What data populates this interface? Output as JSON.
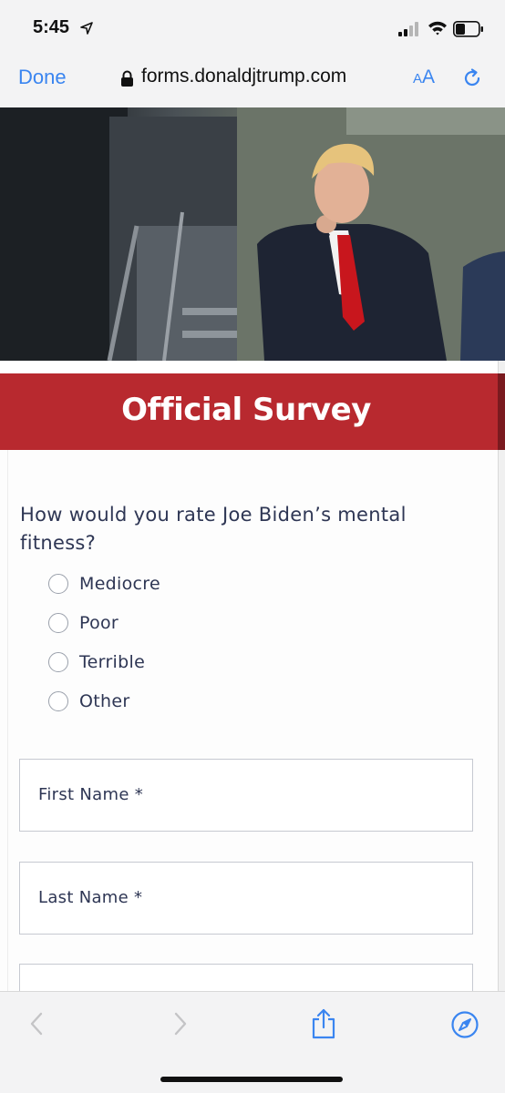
{
  "status_bar": {
    "time": "5:45",
    "icons": [
      "location-arrow-icon",
      "cellular-signal-icon",
      "wifi-icon",
      "battery-icon"
    ]
  },
  "browser": {
    "done_label": "Done",
    "url": "forms.donaldjtrump.com",
    "reader_small": "A",
    "reader_big": "A",
    "accent_color": "#3a85f0"
  },
  "survey": {
    "banner_title": "Official Survey",
    "banner_color": "#b8292f",
    "question": "How would you rate Joe Biden’s mental fitness?",
    "options": [
      {
        "label": "Mediocre",
        "selected": false
      },
      {
        "label": "Poor",
        "selected": false
      },
      {
        "label": "Terrible",
        "selected": false
      },
      {
        "label": "Other",
        "selected": false
      }
    ],
    "fields": [
      {
        "label": "First Name *",
        "value": ""
      },
      {
        "label": "Last Name *",
        "value": ""
      },
      {
        "label": "",
        "value": ""
      }
    ]
  },
  "toolbar": {
    "icons": [
      "back-icon",
      "forward-icon",
      "share-icon",
      "safari-compass-icon"
    ],
    "back_enabled": false,
    "forward_enabled": false
  }
}
